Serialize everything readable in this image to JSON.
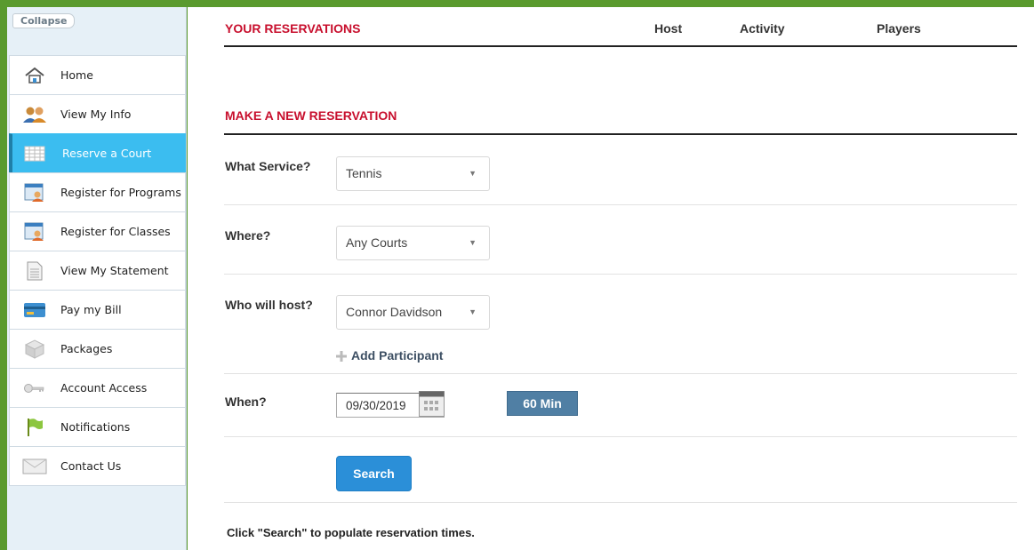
{
  "sidebar": {
    "collapse_label": "Collapse",
    "items": [
      {
        "label": "Home",
        "icon": "home-icon"
      },
      {
        "label": "View My Info",
        "icon": "people-icon"
      },
      {
        "label": "Reserve a Court",
        "icon": "calendar-grid-icon",
        "active": true
      },
      {
        "label": "Register for Programs",
        "icon": "register-icon"
      },
      {
        "label": "Register for Classes",
        "icon": "register-icon"
      },
      {
        "label": "View My Statement",
        "icon": "statement-icon"
      },
      {
        "label": "Pay my Bill",
        "icon": "credit-card-icon"
      },
      {
        "label": "Packages",
        "icon": "package-icon"
      },
      {
        "label": "Account Access",
        "icon": "keys-icon"
      },
      {
        "label": "Notifications",
        "icon": "flag-icon"
      },
      {
        "label": "Contact Us",
        "icon": "envelope-icon"
      }
    ]
  },
  "reservations": {
    "title": "YOUR RESERVATIONS",
    "columns": [
      "Host",
      "Activity",
      "Players"
    ]
  },
  "new_reservation": {
    "title": "MAKE A NEW RESERVATION",
    "service": {
      "label": "What Service?",
      "value": "Tennis"
    },
    "where": {
      "label": "Where?",
      "value": "Any Courts"
    },
    "host": {
      "label": "Who will host?",
      "value": "Connor Davidson"
    },
    "add_participant": "Add Participant",
    "when": {
      "label": "When?",
      "date": "09/30/2019",
      "duration": "60 Min"
    },
    "search_label": "Search",
    "hint": "Click \"Search\" to populate reservation times."
  },
  "colors": {
    "frame": "#5a9a2e",
    "section_title": "#c8102e",
    "active_nav": "#3bbdf0",
    "search_button": "#2b8fd8",
    "duration_button": "#507fa4"
  }
}
